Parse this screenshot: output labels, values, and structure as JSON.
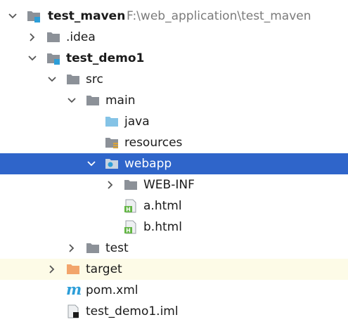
{
  "project": {
    "name": "test_maven",
    "path": "F:\\web_application\\test_maven"
  },
  "tree": {
    "idea": ".idea",
    "module": "test_demo1",
    "src": "src",
    "main": "main",
    "java": "java",
    "resources": "resources",
    "webapp": "webapp",
    "webinf": "WEB-INF",
    "a_html": "a.html",
    "b_html": "b.html",
    "test": "test",
    "target": "target",
    "pom": "pom.xml",
    "iml": "test_demo1.iml"
  },
  "icons": {
    "folder": "folder-icon",
    "module": "module-folder-icon",
    "source": "source-folder-icon",
    "resources": "resources-folder-icon",
    "web": "web-folder-icon",
    "excluded": "excluded-folder-icon",
    "html": "html-file-icon",
    "maven": "maven-icon",
    "iml": "iml-file-icon"
  },
  "colors": {
    "selection": "#2f65ca",
    "excluded_bg": "#fdfbe7",
    "folder": "#8c9198",
    "source_folder": "#84c3e6",
    "excluded_folder": "#f2a56b",
    "html_badge": "#62b543",
    "maven": "#2d9ed8"
  }
}
